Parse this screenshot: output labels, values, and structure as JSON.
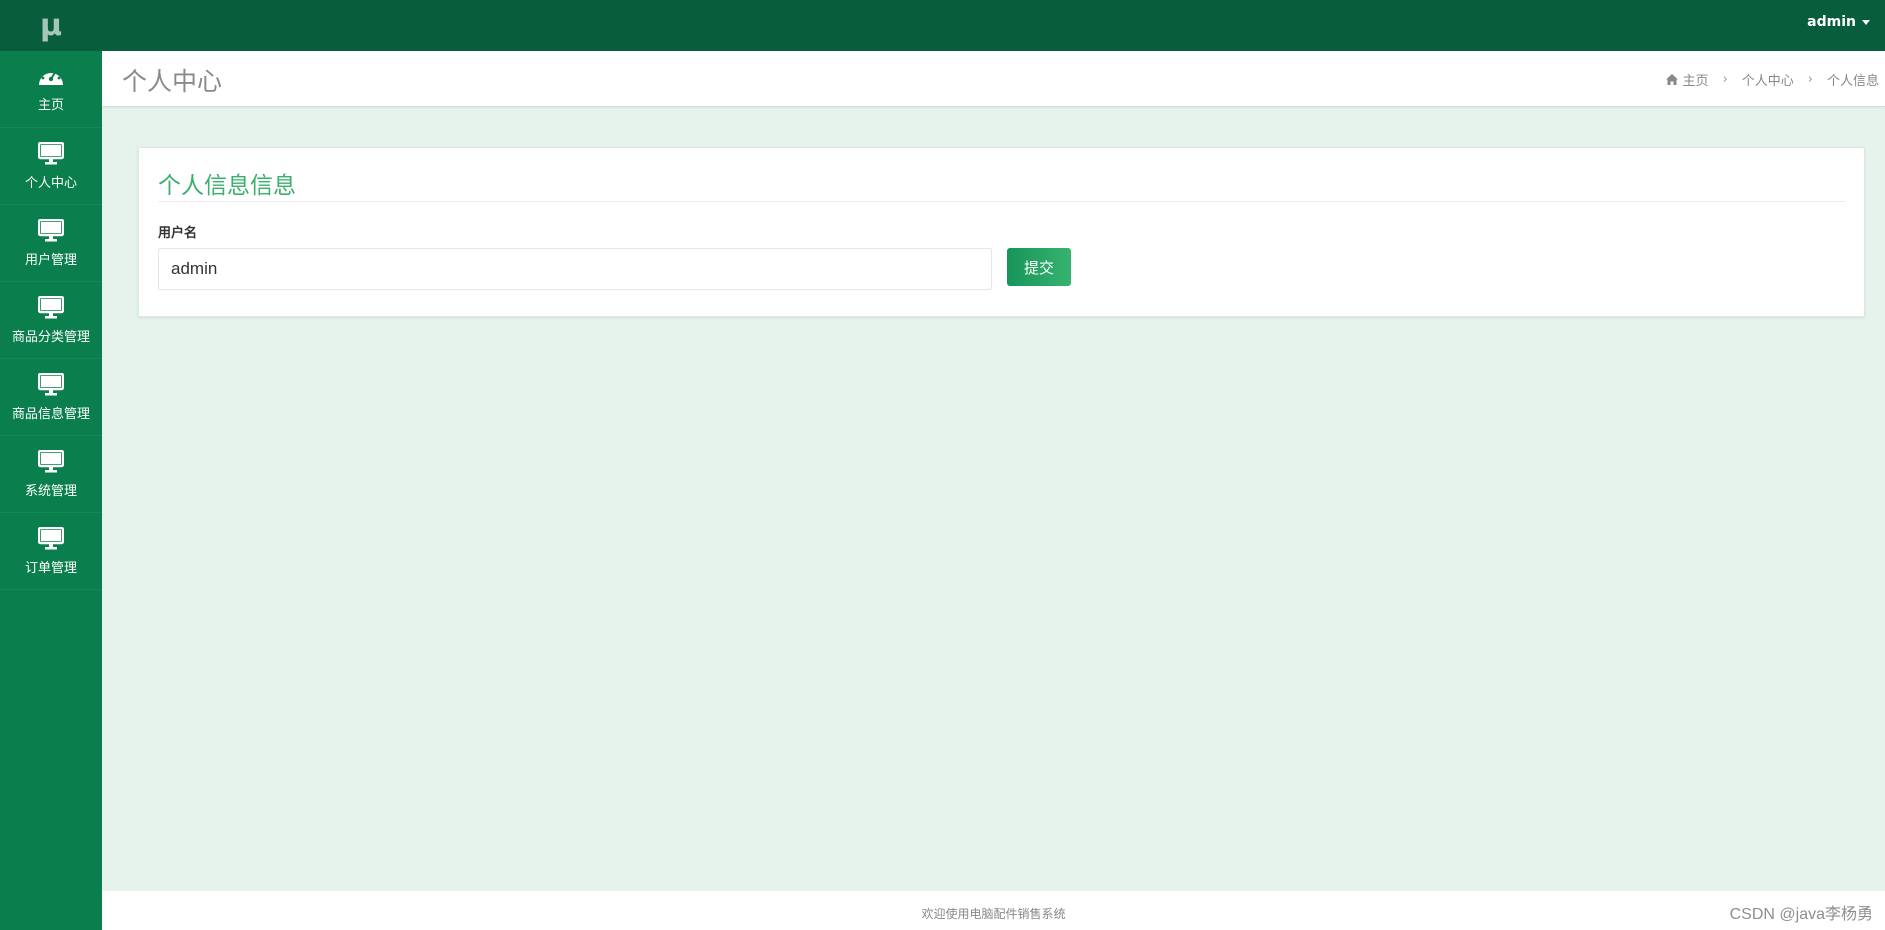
{
  "app": {
    "logo": "μ"
  },
  "sidebar": {
    "items": [
      {
        "label": "主页",
        "icon": "dashboard-icon"
      },
      {
        "label": "个人中心",
        "icon": "monitor-icon"
      },
      {
        "label": "用户管理",
        "icon": "monitor-icon"
      },
      {
        "label": "商品分类管理",
        "icon": "monitor-icon"
      },
      {
        "label": "商品信息管理",
        "icon": "monitor-icon"
      },
      {
        "label": "系统管理",
        "icon": "monitor-icon"
      },
      {
        "label": "订单管理",
        "icon": "monitor-icon"
      }
    ]
  },
  "topbar": {
    "user": "admin"
  },
  "header": {
    "title": "个人中心",
    "breadcrumb": [
      "主页",
      "个人中心",
      "个人信息"
    ]
  },
  "card": {
    "title": "个人信息信息",
    "field_label": "用户名",
    "username_value": "admin",
    "submit_label": "提交"
  },
  "footer": {
    "text": "欢迎使用电脑配件销售系统",
    "watermark": "CSDN @java李杨勇"
  },
  "colors": {
    "sidebar": "#0a7f4d",
    "topbar": "#085d3d",
    "accent": "#3bb06d",
    "content_bg": "#e6f2ec"
  }
}
